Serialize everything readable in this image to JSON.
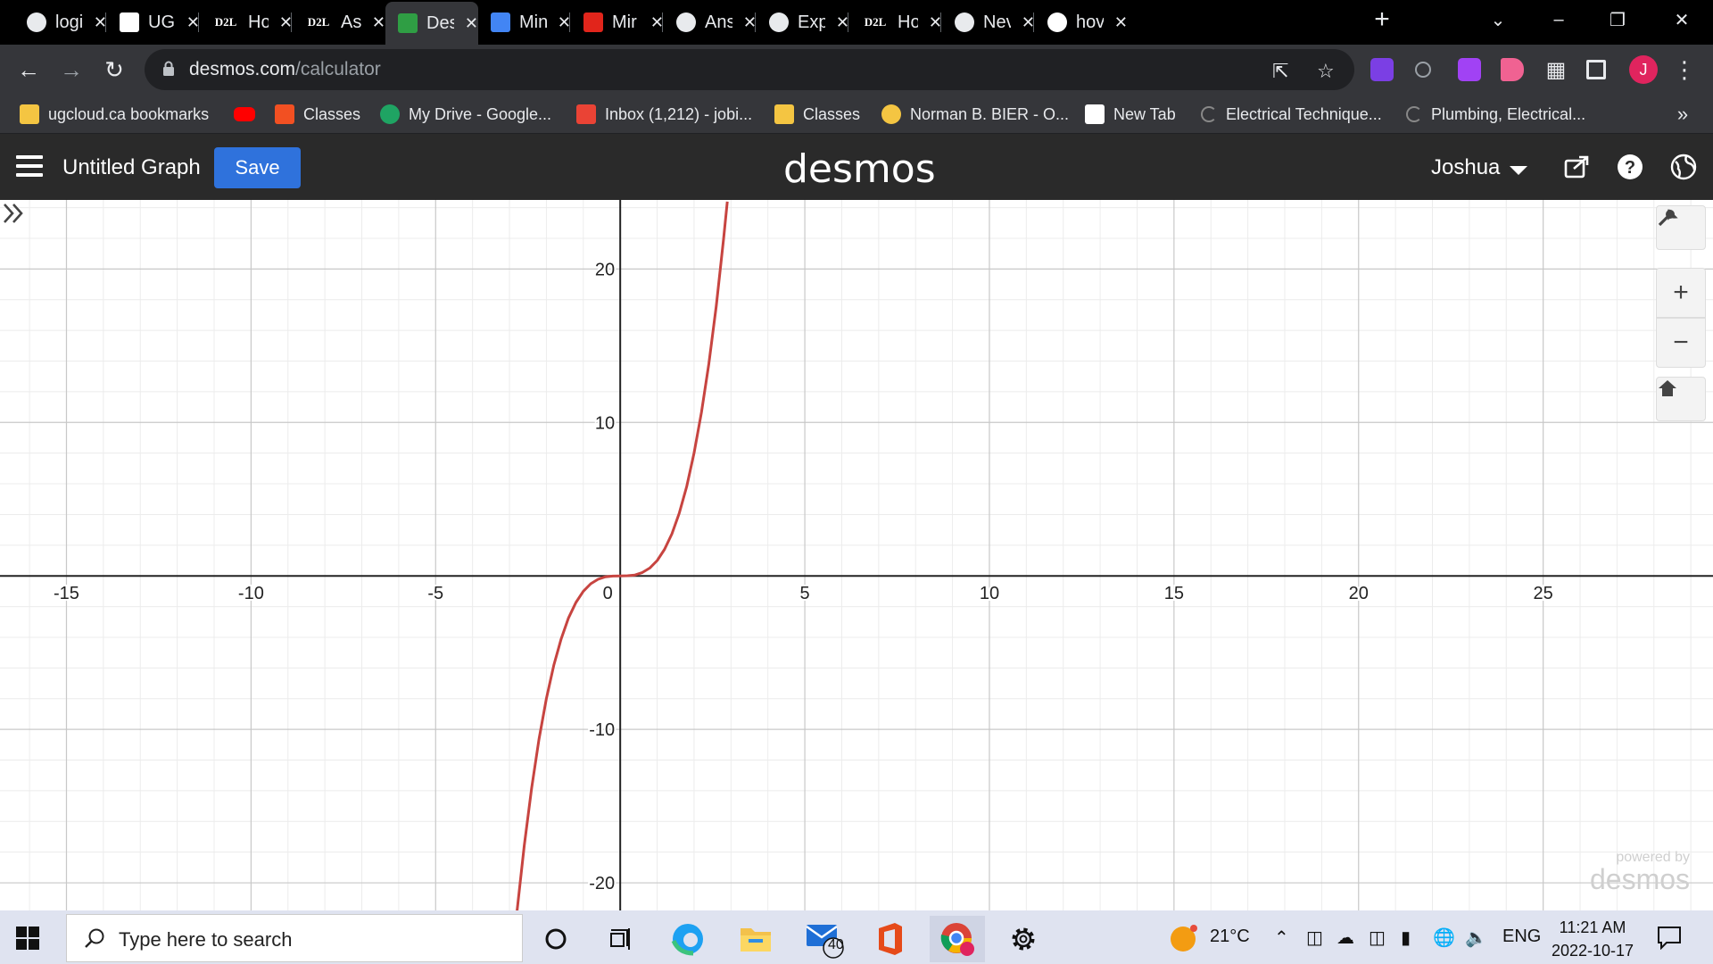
{
  "browser": {
    "tabs": [
      {
        "title": "logi",
        "icon": "globe-icon",
        "active": false
      },
      {
        "title": "UG",
        "icon": "ugcloud-icon",
        "active": false
      },
      {
        "title": "Hor",
        "icon": "d2l-icon",
        "active": false
      },
      {
        "title": "Assi",
        "icon": "d2l-icon",
        "active": false
      },
      {
        "title": "Des",
        "icon": "desmos-icon",
        "active": true
      },
      {
        "title": "Min",
        "icon": "docs-icon",
        "active": false
      },
      {
        "title": "Mir",
        "icon": "adobe-icon",
        "active": false
      },
      {
        "title": "Ans",
        "icon": "globe-icon",
        "active": false
      },
      {
        "title": "Exp",
        "icon": "globe-icon",
        "active": false
      },
      {
        "title": "Hor",
        "icon": "d2l-icon",
        "active": false
      },
      {
        "title": "Nev",
        "icon": "chrome-icon",
        "active": false
      },
      {
        "title": "hov",
        "icon": "google-icon",
        "active": false
      }
    ],
    "d2l_label": "D2L",
    "url_host": "desmos.com",
    "url_path": "/calculator",
    "profile_initial": "J",
    "bookmarks": [
      {
        "label": "ugcloud.ca bookmarks",
        "icon": "folder-icon",
        "color": "#f4c542"
      },
      {
        "label": "",
        "icon": "youtube-icon",
        "color": "#ff0000"
      },
      {
        "label": "Classes",
        "icon": "microsoft-icon",
        "color": "#f25022"
      },
      {
        "label": "My Drive - Google...",
        "icon": "drive-icon",
        "color": "#1fa463"
      },
      {
        "label": "Inbox (1,212) - jobi...",
        "icon": "gmail-icon",
        "color": "#ea4335"
      },
      {
        "label": "Classes",
        "icon": "classroom-icon",
        "color": "#f4c542"
      },
      {
        "label": "Norman B. BIER - O...",
        "icon": "bier-icon",
        "color": "#f4c542"
      },
      {
        "label": "New Tab",
        "icon": "ugcloud-icon",
        "color": "#ffffff"
      },
      {
        "label": "Electrical Technique...",
        "icon": "loading-icon",
        "color": "#888888"
      },
      {
        "label": "Plumbing, Electrical...",
        "icon": "loading-icon",
        "color": "#888888"
      }
    ]
  },
  "desmos": {
    "graph_title": "Untitled Graph",
    "save_label": "Save",
    "logo": "desmos",
    "user_name": "Joshua",
    "powered_by": "powered by",
    "powered_logo": "desmos"
  },
  "chart_data": {
    "type": "line",
    "title": "",
    "xlabel": "",
    "ylabel": "",
    "xlim": [
      -16.8,
      29.6
    ],
    "ylim": [
      -21.8,
      24.5
    ],
    "x_ticks": [
      -15,
      -10,
      -5,
      0,
      5,
      10,
      15,
      20,
      25
    ],
    "x_tick_labels": [
      "-15",
      "-10",
      "-5",
      "0",
      "5",
      "10",
      "15",
      "20",
      "25"
    ],
    "y_ticks": [
      -20,
      -10,
      10,
      20
    ],
    "y_tick_labels": [
      "-20",
      "-10",
      "10",
      "20"
    ],
    "grid": true,
    "series": [
      {
        "color": "#c74440",
        "x": [
          -2.8,
          -2.6,
          -2.4,
          -2.2,
          -2.0,
          -1.8,
          -1.6,
          -1.4,
          -1.2,
          -1.0,
          -0.8,
          -0.6,
          -0.4,
          -0.2,
          0.0,
          0.2,
          0.4,
          0.6,
          0.8,
          1.0,
          1.2,
          1.4,
          1.6,
          1.8,
          2.0,
          2.2,
          2.4,
          2.6,
          2.8,
          2.9
        ],
        "y": [
          -21.95,
          -17.58,
          -13.82,
          -10.65,
          -8.0,
          -5.83,
          -4.1,
          -2.74,
          -1.73,
          -1.0,
          -0.51,
          -0.22,
          -0.06,
          -0.01,
          0.0,
          0.01,
          0.06,
          0.22,
          0.51,
          1.0,
          1.73,
          2.74,
          4.1,
          5.83,
          8.0,
          10.65,
          13.82,
          17.58,
          21.95,
          24.39
        ]
      }
    ]
  },
  "taskbar": {
    "search_placeholder": "Type here to search",
    "mail_badge": "40",
    "weather": "21°C",
    "language": "ENG",
    "time": "11:21 AM",
    "date": "2022-10-17",
    "accent": "#1f6fd6"
  }
}
